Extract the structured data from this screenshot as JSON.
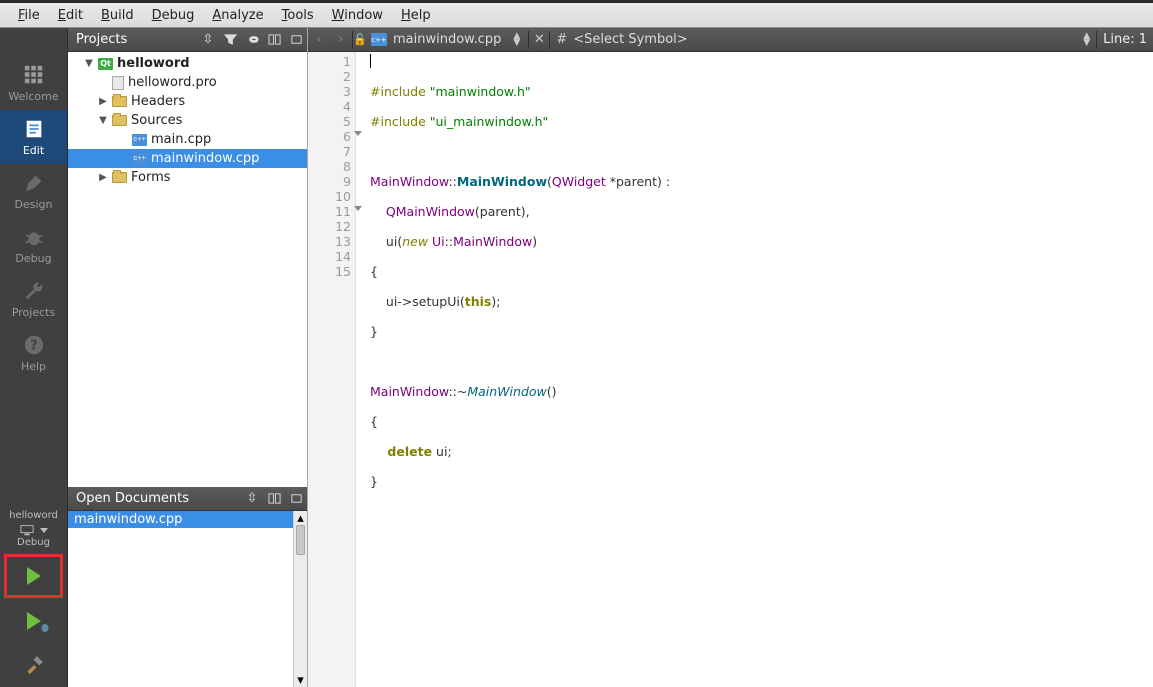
{
  "menu": {
    "file": "File",
    "edit": "Edit",
    "build": "Build",
    "debug": "Debug",
    "analyze": "Analyze",
    "tools": "Tools",
    "window": "Window",
    "help": "Help"
  },
  "modes": {
    "welcome": "Welcome",
    "edit": "Edit",
    "design": "Design",
    "debug": "Debug",
    "projects": "Projects",
    "help": "Help"
  },
  "target": {
    "project": "helloword",
    "kit": "Debug"
  },
  "projects_panel": {
    "title": "Projects",
    "root": "helloword",
    "pro_file": "helloword.pro",
    "headers": "Headers",
    "sources": "Sources",
    "sources_items": [
      "main.cpp",
      "mainwindow.cpp"
    ],
    "forms": "Forms"
  },
  "open_docs": {
    "title": "Open Documents",
    "items": [
      "mainwindow.cpp"
    ]
  },
  "editor": {
    "filename": "mainwindow.cpp",
    "symbol_placeholder": "<Select Symbol>",
    "line_indicator": "Line: 1",
    "line_count": 15
  },
  "code": {
    "l1_include": "#include",
    "l1_str": "\"mainwindow.h\"",
    "l2_include": "#include",
    "l2_str": "\"ui_mainwindow.h\"",
    "l4_mw": "MainWindow",
    "l4_cc": "::",
    "l4_ctor": "MainWindow",
    "l4_open": "(",
    "l4_qw": "QWidget",
    "l4_star": " *",
    "l4_parent": "parent",
    "l4_close": ")",
    "l4_colon": " :",
    "l5_qmw": "QMainWindow",
    "l5_open": "(",
    "l5_parent": "parent",
    "l5_close": "),",
    "l6_ui": "ui",
    "l6_open": "(",
    "l6_new": "new",
    "l6_uins": " Ui",
    "l6_cc": "::",
    "l6_mw": "MainWindow",
    "l6_close": ")",
    "l7": "{",
    "l8_ui": "    ui",
    "l8_arrow": "->",
    "l8_setup": "setupUi",
    "l8_open": "(",
    "l8_this": "this",
    "l8_close": ");",
    "l9": "}",
    "l11_mw": "MainWindow",
    "l11_cc": "::~",
    "l11_dtor": "MainWindow",
    "l11_par": "()",
    "l12": "{",
    "l13_del": "    delete",
    "l13_ui": " ui",
    "l13_semi": ";",
    "l14": "}"
  }
}
